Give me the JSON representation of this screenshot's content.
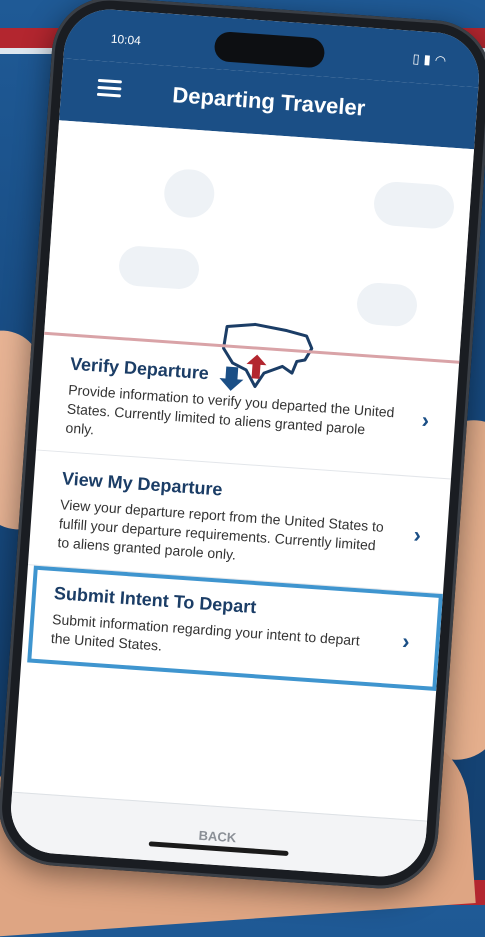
{
  "status": {
    "time": "10:04"
  },
  "appbar": {
    "title": "Departing Traveler"
  },
  "menu": [
    {
      "title": "Verify Departure",
      "description": "Provide information to verify you departed the United States. Currently limited to aliens granted parole only."
    },
    {
      "title": "View My Departure",
      "description": "View your departure report from the United States to fulfill your departure requirements. Currently limited to aliens granted parole only."
    },
    {
      "title": "Submit Intent To Depart",
      "description": "Submit information regarding your intent to depart the United States."
    }
  ],
  "footer": {
    "back_label": "BACK"
  },
  "colors": {
    "brand": "#1b4f86",
    "accent_red": "#b3262f",
    "selected_border": "#3f95cf"
  }
}
